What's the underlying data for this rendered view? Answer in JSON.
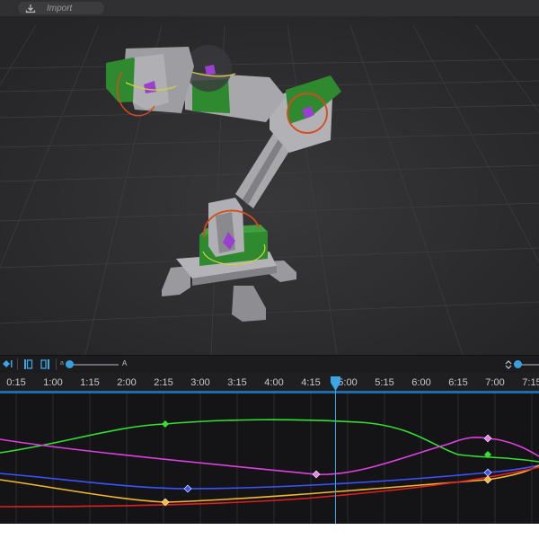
{
  "topbar": {
    "import_label": "Import",
    "import_icon": "download-icon"
  },
  "toolbar": {
    "icons": [
      "keyframe-step-icon",
      "clip-start-icon",
      "clip-end-icon",
      "stepper-icon"
    ],
    "amplitude_min_label": "a",
    "amplitude_max_label": "A"
  },
  "timeline": {
    "ticks": [
      "0:15",
      "1:00",
      "1:15",
      "2:00",
      "2:15",
      "3:00",
      "3:15",
      "4:00",
      "4:15",
      "5:00",
      "5:15",
      "6:00",
      "6:15",
      "7:00",
      "7:15"
    ],
    "playhead_time": "4:49",
    "curves": [
      {
        "color": "#33e033",
        "keys": [
          "2:15",
          "7:00"
        ]
      },
      {
        "color": "#e040e0",
        "keys": [
          "4:15",
          "7:00"
        ]
      },
      {
        "color": "#3a55ff",
        "keys": [
          "2:30",
          "7:00"
        ]
      },
      {
        "color": "#f5b92e",
        "keys": [
          "2:15",
          "7:00"
        ]
      },
      {
        "color": "#e02020",
        "keys": []
      }
    ]
  },
  "colors": {
    "accent": "#39a0e0",
    "robot_green": "#2f8a2f",
    "robot_gray": "#a6a6aa",
    "gizmo_purple": "#a050e0"
  }
}
